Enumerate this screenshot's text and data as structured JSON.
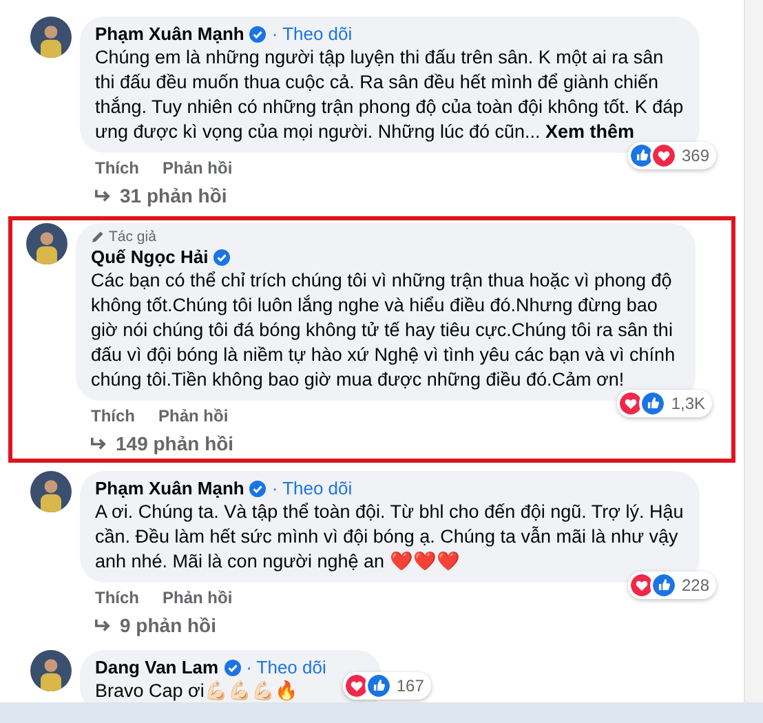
{
  "comments": [
    {
      "author": "Phạm Xuân Mạnh",
      "verified": true,
      "follow": "· Theo dõi",
      "highlighted": false,
      "text": "Chúng em là những người tập luyện thi đấu trên sân. K một ai ra sân thi đấu đều muốn thua cuộc cả. Ra sân đều hết mình để giành chiến thắng. Tuy nhiên có những trận phong độ của toàn đội không tốt. K đáp ưng được kì vọng của mọi người. Những lúc đó cũn... **Xem thêm**",
      "reactions": [
        {
          "kind": "like"
        },
        {
          "kind": "love"
        }
      ],
      "reaction_count": "369",
      "actions": [
        "Thích",
        "Phản hồi"
      ],
      "replies": "31 phản hồi"
    },
    {
      "author": "Quế Ngọc Hải",
      "verified": true,
      "author_badge": "Tác giả",
      "highlighted": true,
      "text": "Các bạn có thể chỉ trích chúng tôi vì những trận thua hoặc vì phong độ không tốt.Chúng tôi luôn lắng nghe và hiểu điều đó.Nhưng đừng bao giờ nói chúng tôi đá bóng không tử tế hay tiêu cực.Chúng tôi ra sân thi đấu vì đội bóng là niềm tự hào xứ Nghệ vì tình yêu các bạn và vì chính chúng tôi.Tiền không bao giờ mua được những điều đó.Cảm ơn!",
      "reactions": [
        {
          "kind": "love"
        },
        {
          "kind": "like"
        }
      ],
      "reaction_count": "1,3K",
      "actions": [
        "Thích",
        "Phản hồi"
      ],
      "replies": "149 phản hồi"
    },
    {
      "author": "Phạm Xuân Mạnh",
      "verified": true,
      "follow": "· Theo dõi",
      "highlighted": false,
      "text": "A ơi. Chúng ta. Và tập thể toàn đội. Từ bhl cho đến đội ngũ. Trợ lý. Hậu cần. Đều làm hết sức mình vì đội bóng ạ. Chúng ta vẫn mãi là như vậy anh nhé. Mãi là con người nghệ an ❤️❤️❤️",
      "reactions": [
        {
          "kind": "love"
        },
        {
          "kind": "like"
        }
      ],
      "reaction_count": "228",
      "actions": [
        "Thích",
        "Phản hồi"
      ],
      "replies": "9 phản hồi"
    },
    {
      "author": "Dang Van Lam",
      "verified": true,
      "follow": "· Theo dõi",
      "highlighted": false,
      "text": "Bravo Cap ơi💪🏻💪🏻💪🏻🔥",
      "reactions": [
        {
          "kind": "love"
        },
        {
          "kind": "like"
        }
      ],
      "reaction_count": "167"
    }
  ]
}
